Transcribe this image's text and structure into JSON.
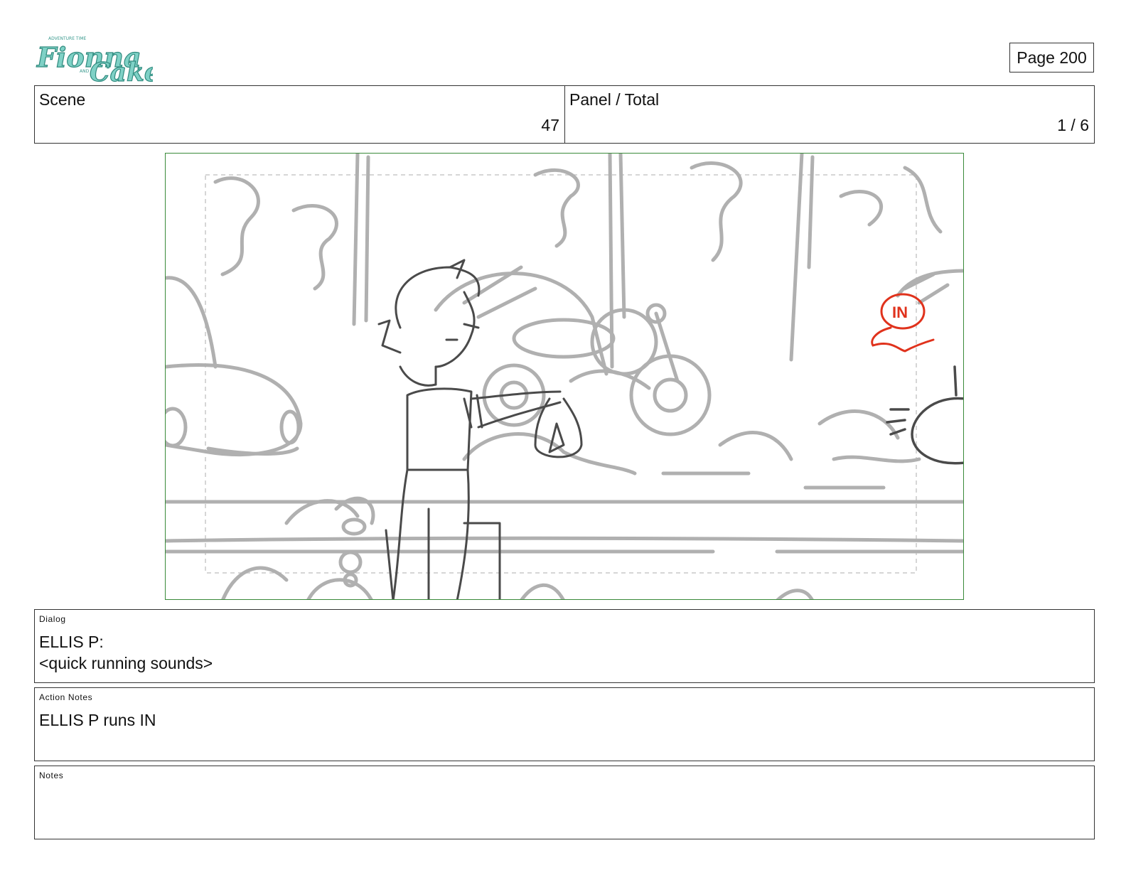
{
  "logo": {
    "small_text": "ADVENTURE TIME",
    "word_a": "Fionna",
    "and": "AND",
    "word_b": "Cake"
  },
  "page": {
    "label": "Page 200"
  },
  "header": {
    "scene_label": "Scene",
    "scene_value": "47",
    "panel_label": "Panel / Total",
    "panel_value": "1 / 6"
  },
  "frame": {
    "annotation": "IN",
    "annotation_color": "#e0321c",
    "border_color": "#3a8a3a"
  },
  "dialog": {
    "label": "Dialog",
    "speaker": "ELLIS P:",
    "line": "<quick running sounds>"
  },
  "action_notes": {
    "label": "Action Notes",
    "text": "ELLIS P runs IN"
  },
  "notes": {
    "label": "Notes",
    "text": ""
  }
}
